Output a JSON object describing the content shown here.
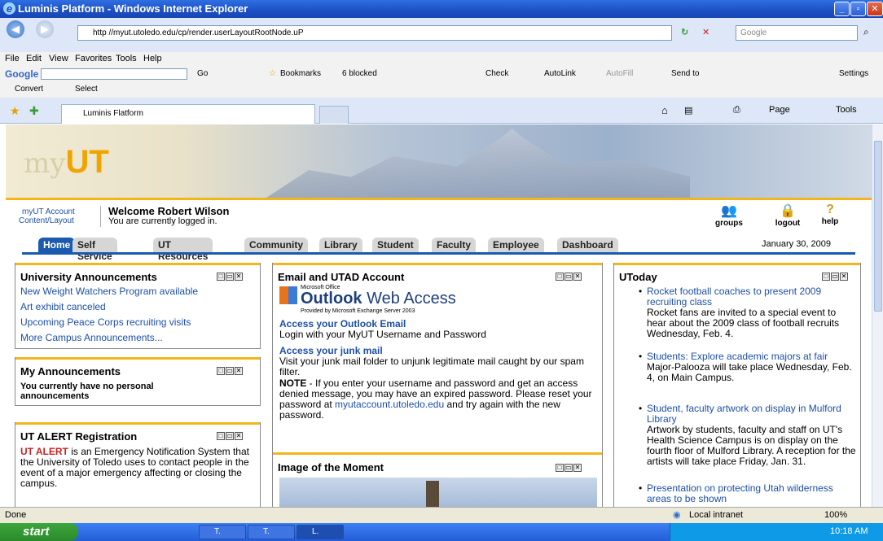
{
  "window": {
    "title": "Luminis Platform - Windows Internet Explorer"
  },
  "browser": {
    "address": "http //myut.utoledo.edu/cp/render.userLayoutRootNode.uP",
    "search_placeholder": "Google",
    "menu": [
      "File",
      "Edit",
      "View",
      "Favorites",
      "Tools",
      "Help"
    ],
    "google_toolbar": {
      "go": "Go",
      "bookmarks": "Bookmarks",
      "blocked": "6 blocked",
      "check": "Check",
      "autolink": "AutoLink",
      "autofill": "AutoFill",
      "sendto": "Send to",
      "settings": "Settings"
    },
    "convert": "Convert",
    "select": "Select",
    "tab_label": "Luminis Flatform",
    "cmd": {
      "page": "Page",
      "tools": "Tools"
    },
    "status": "Done",
    "zone": "Local intranet",
    "zoom": "100%"
  },
  "portal": {
    "logo_my": "my",
    "logo_ut": "UT",
    "account_link1": "myUT Account",
    "account_link2": "Content/Layout",
    "welcome": "Welcome Robert Wilson",
    "logged_in": "You are currently logged in.",
    "actions": {
      "groups": "groups",
      "logout": "logout",
      "help": "help"
    },
    "tabs": [
      "Home",
      "Self Service",
      "UT Resources",
      "Community",
      "Library",
      "Student",
      "Faculty",
      "Employee",
      "Dashboard"
    ],
    "date": "January 30, 2009"
  },
  "announcements": {
    "title": "University Announcements",
    "items": [
      "New Weight Watchers Program available",
      "Art exhibit canceled",
      "Upcoming Peace Corps recruiting visits",
      "More Campus Announcements..."
    ]
  },
  "my_announcements": {
    "title": "My Announcements",
    "body": "You currently have no personal announcements"
  },
  "ut_alert": {
    "title": "UT ALERT Registration",
    "lead": "UT ALERT",
    "body": " is an Emergency Notification System that the University of Toledo uses to contact people in the event of a major emergency affecting or closing the campus."
  },
  "email": {
    "title": "Email and UTAD Account",
    "ms_office": "Microsoft Office",
    "outlook": "Outlook",
    "web_access": "Web Access",
    "provided": "Provided by Microsoft Exchange Server 2003",
    "link1": "Access your Outlook Email",
    "text1": "Login with your MyUT Username and Password",
    "link2": "Access your junk mail",
    "text2": "Visit your junk mail folder to unjunk legitimate mail caught by our spam filter.",
    "note_label": "NOTE",
    "note_text": " - If you enter your username and password and get an access denied message, you may have an expired password. Please reset your password at ",
    "note_link": "myutaccount.utoledo.edu",
    "note_tail": " and try again with the new password."
  },
  "image_of_moment": {
    "title": "Image of the Moment"
  },
  "utoday": {
    "title": "UToday",
    "items": [
      {
        "headline": "Rocket football coaches to present 2009 recruiting class",
        "body": "Rocket fans are invited to a special event to hear about the 2009 class of football recruits Wednesday, Feb. 4."
      },
      {
        "headline": "Students: Explore academic majors at fair",
        "body": "Major-Palooza will take place Wednesday, Feb. 4, on Main Campus."
      },
      {
        "headline": "Student, faculty artwork on display in Mulford Library",
        "body": "Artwork by students, faculty and staff on UT's Health Science Campus is on display on the fourth floor of Mulford Library. A reception for the artists will take place Friday, Jan. 31."
      },
      {
        "headline": "Presentation on protecting Utah wilderness areas to be shown",
        "body": ""
      }
    ]
  },
  "taskbar": {
    "start": "start",
    "btn1": "T.",
    "btn2": "T.",
    "btn3": "L.",
    "time": "10:18 AM"
  }
}
